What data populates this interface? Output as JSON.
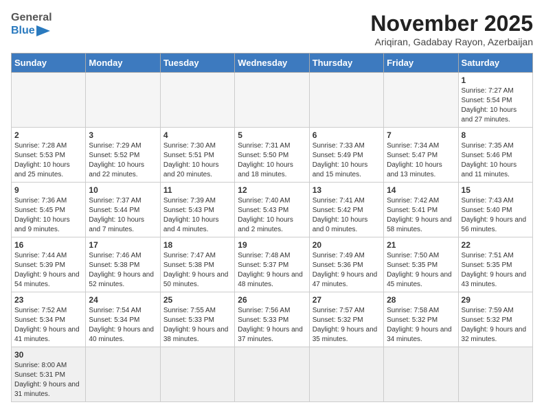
{
  "header": {
    "logo_general": "General",
    "logo_blue": "Blue",
    "title": "November 2025",
    "subtitle": "Ariqiran, Gadabay Rayon, Azerbaijan"
  },
  "weekdays": [
    "Sunday",
    "Monday",
    "Tuesday",
    "Wednesday",
    "Thursday",
    "Friday",
    "Saturday"
  ],
  "weeks": [
    [
      {
        "day": "",
        "info": ""
      },
      {
        "day": "",
        "info": ""
      },
      {
        "day": "",
        "info": ""
      },
      {
        "day": "",
        "info": ""
      },
      {
        "day": "",
        "info": ""
      },
      {
        "day": "",
        "info": ""
      },
      {
        "day": "1",
        "info": "Sunrise: 7:27 AM\nSunset: 5:54 PM\nDaylight: 10 hours\nand 27 minutes."
      }
    ],
    [
      {
        "day": "2",
        "info": "Sunrise: 7:28 AM\nSunset: 5:53 PM\nDaylight: 10 hours\nand 25 minutes."
      },
      {
        "day": "3",
        "info": "Sunrise: 7:29 AM\nSunset: 5:52 PM\nDaylight: 10 hours\nand 22 minutes."
      },
      {
        "day": "4",
        "info": "Sunrise: 7:30 AM\nSunset: 5:51 PM\nDaylight: 10 hours\nand 20 minutes."
      },
      {
        "day": "5",
        "info": "Sunrise: 7:31 AM\nSunset: 5:50 PM\nDaylight: 10 hours\nand 18 minutes."
      },
      {
        "day": "6",
        "info": "Sunrise: 7:33 AM\nSunset: 5:49 PM\nDaylight: 10 hours\nand 15 minutes."
      },
      {
        "day": "7",
        "info": "Sunrise: 7:34 AM\nSunset: 5:47 PM\nDaylight: 10 hours\nand 13 minutes."
      },
      {
        "day": "8",
        "info": "Sunrise: 7:35 AM\nSunset: 5:46 PM\nDaylight: 10 hours\nand 11 minutes."
      }
    ],
    [
      {
        "day": "9",
        "info": "Sunrise: 7:36 AM\nSunset: 5:45 PM\nDaylight: 10 hours\nand 9 minutes."
      },
      {
        "day": "10",
        "info": "Sunrise: 7:37 AM\nSunset: 5:44 PM\nDaylight: 10 hours\nand 7 minutes."
      },
      {
        "day": "11",
        "info": "Sunrise: 7:39 AM\nSunset: 5:43 PM\nDaylight: 10 hours\nand 4 minutes."
      },
      {
        "day": "12",
        "info": "Sunrise: 7:40 AM\nSunset: 5:43 PM\nDaylight: 10 hours\nand 2 minutes."
      },
      {
        "day": "13",
        "info": "Sunrise: 7:41 AM\nSunset: 5:42 PM\nDaylight: 10 hours\nand 0 minutes."
      },
      {
        "day": "14",
        "info": "Sunrise: 7:42 AM\nSunset: 5:41 PM\nDaylight: 9 hours\nand 58 minutes."
      },
      {
        "day": "15",
        "info": "Sunrise: 7:43 AM\nSunset: 5:40 PM\nDaylight: 9 hours\nand 56 minutes."
      }
    ],
    [
      {
        "day": "16",
        "info": "Sunrise: 7:44 AM\nSunset: 5:39 PM\nDaylight: 9 hours\nand 54 minutes."
      },
      {
        "day": "17",
        "info": "Sunrise: 7:46 AM\nSunset: 5:38 PM\nDaylight: 9 hours\nand 52 minutes."
      },
      {
        "day": "18",
        "info": "Sunrise: 7:47 AM\nSunset: 5:38 PM\nDaylight: 9 hours\nand 50 minutes."
      },
      {
        "day": "19",
        "info": "Sunrise: 7:48 AM\nSunset: 5:37 PM\nDaylight: 9 hours\nand 48 minutes."
      },
      {
        "day": "20",
        "info": "Sunrise: 7:49 AM\nSunset: 5:36 PM\nDaylight: 9 hours\nand 47 minutes."
      },
      {
        "day": "21",
        "info": "Sunrise: 7:50 AM\nSunset: 5:35 PM\nDaylight: 9 hours\nand 45 minutes."
      },
      {
        "day": "22",
        "info": "Sunrise: 7:51 AM\nSunset: 5:35 PM\nDaylight: 9 hours\nand 43 minutes."
      }
    ],
    [
      {
        "day": "23",
        "info": "Sunrise: 7:52 AM\nSunset: 5:34 PM\nDaylight: 9 hours\nand 41 minutes."
      },
      {
        "day": "24",
        "info": "Sunrise: 7:54 AM\nSunset: 5:34 PM\nDaylight: 9 hours\nand 40 minutes."
      },
      {
        "day": "25",
        "info": "Sunrise: 7:55 AM\nSunset: 5:33 PM\nDaylight: 9 hours\nand 38 minutes."
      },
      {
        "day": "26",
        "info": "Sunrise: 7:56 AM\nSunset: 5:33 PM\nDaylight: 9 hours\nand 37 minutes."
      },
      {
        "day": "27",
        "info": "Sunrise: 7:57 AM\nSunset: 5:32 PM\nDaylight: 9 hours\nand 35 minutes."
      },
      {
        "day": "28",
        "info": "Sunrise: 7:58 AM\nSunset: 5:32 PM\nDaylight: 9 hours\nand 34 minutes."
      },
      {
        "day": "29",
        "info": "Sunrise: 7:59 AM\nSunset: 5:32 PM\nDaylight: 9 hours\nand 32 minutes."
      }
    ],
    [
      {
        "day": "30",
        "info": "Sunrise: 8:00 AM\nSunset: 5:31 PM\nDaylight: 9 hours\nand 31 minutes."
      },
      {
        "day": "",
        "info": ""
      },
      {
        "day": "",
        "info": ""
      },
      {
        "day": "",
        "info": ""
      },
      {
        "day": "",
        "info": ""
      },
      {
        "day": "",
        "info": ""
      },
      {
        "day": "",
        "info": ""
      }
    ]
  ]
}
